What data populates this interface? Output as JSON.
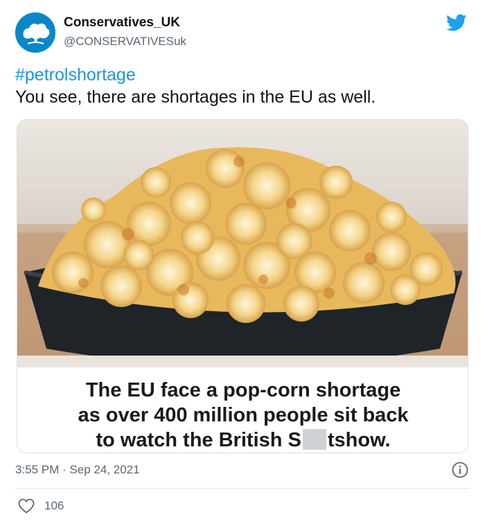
{
  "tweet": {
    "author_name": "Conservatives_UK",
    "author_handle": "@CONSERVATIVESuk",
    "hashtag": "#petrolshortage",
    "text": "You see, there are shortages in the EU as well.",
    "timestamp": "3:55 PM · Sep 24, 2021",
    "likes": "106"
  },
  "media": {
    "caption_line1": "The EU face a pop-corn shortage",
    "caption_line2": "as over 400 million people sit back",
    "caption_line3_before": "to watch the British S",
    "caption_line3_after": "tshow."
  },
  "colors": {
    "link": "#1b95e0",
    "twitter_blue": "#1da1f2",
    "avatar_bg": "#0a87c9"
  },
  "icons": {
    "platform": "twitter-bird-icon",
    "info": "info-icon",
    "like": "heart-icon"
  }
}
